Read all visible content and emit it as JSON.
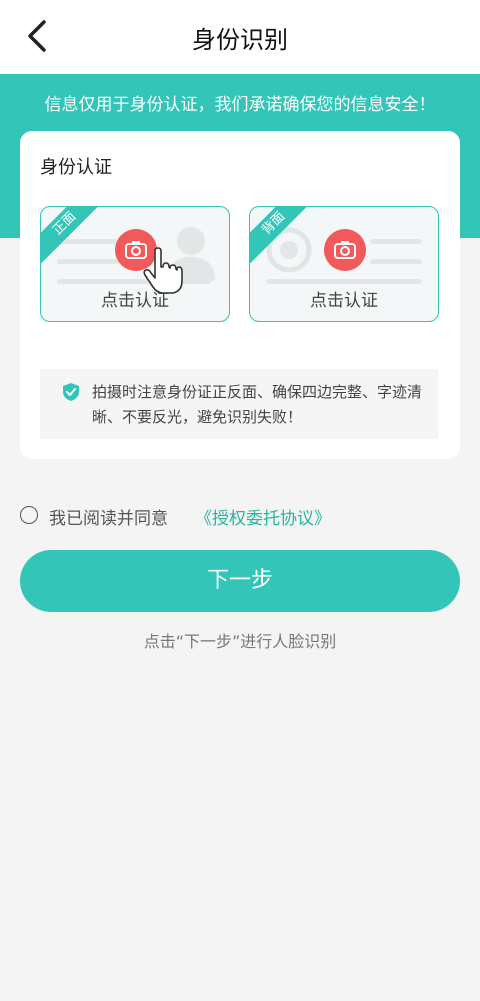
{
  "header": {
    "title": "身份识别"
  },
  "banner": {
    "text": "信息仅用于身份认证，我们承诺确保您的信息安全！"
  },
  "card": {
    "title": "身份认证",
    "front": {
      "tag": "正面",
      "label": "点击认证"
    },
    "back": {
      "tag": "背面",
      "label": "点击认证"
    },
    "tip": "拍摄时注意身份证正反面、确保四边完整、字迹清晰、不要反光，避免识别失败！"
  },
  "agreement": {
    "text": "我已阅读并同意",
    "link": "《授权委托协议》",
    "checked": false
  },
  "next_button": {
    "label": "下一步"
  },
  "hint": {
    "text": "点击“下一步”进行人脸识别"
  },
  "colors": {
    "accent": "#33c6b8",
    "camera": "#f2595b"
  },
  "icons": [
    "back-arrow-icon",
    "camera-icon",
    "hand-pointer-icon",
    "portrait-icon",
    "emblem-icon",
    "shield-check-icon"
  ]
}
